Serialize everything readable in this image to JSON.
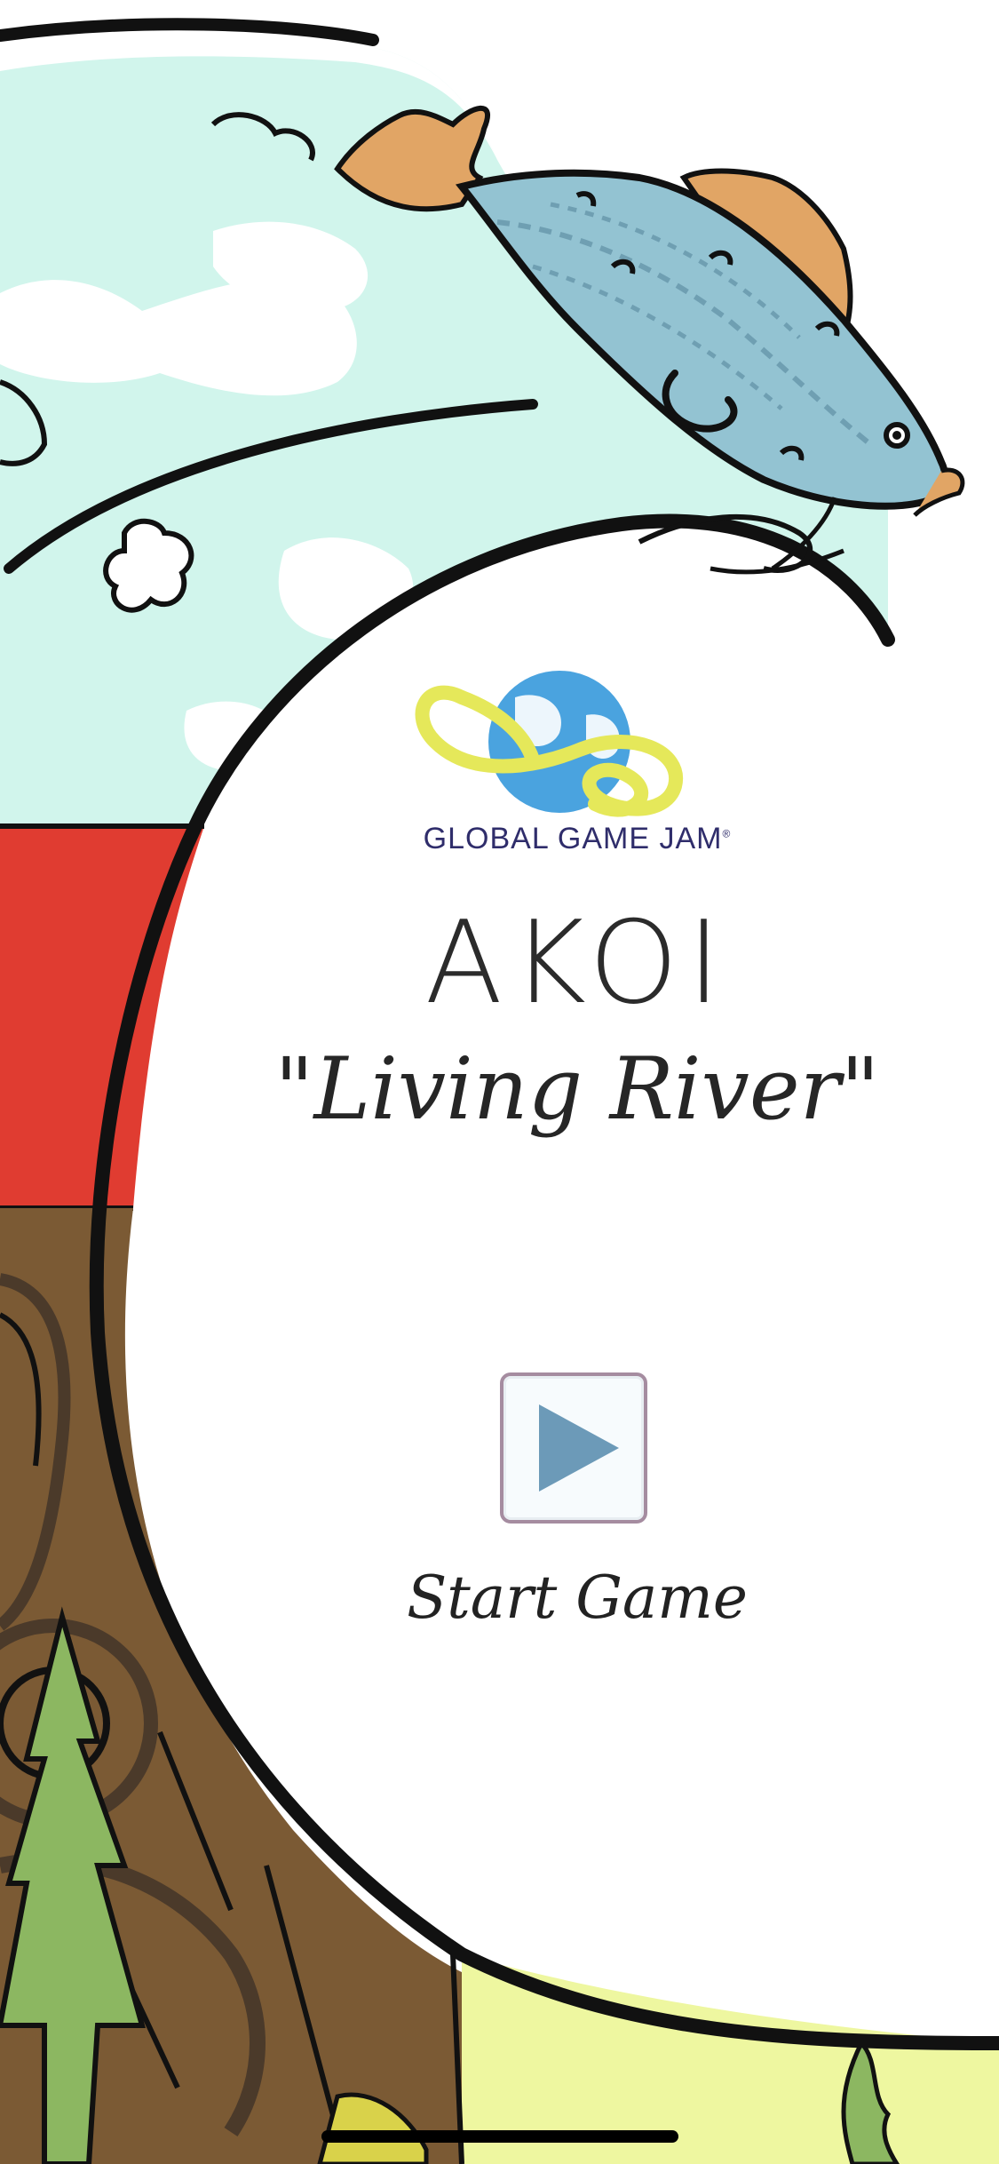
{
  "sponsor": {
    "logo_text": "GLOBAL GAME JAM",
    "registered_mark": "®"
  },
  "game": {
    "title": "AKOI",
    "subtitle": "\"Living River\""
  },
  "menu": {
    "start_label": "Start Game",
    "play_icon": "play-triangle-icon"
  },
  "colors": {
    "sky": "#d1f5ec",
    "red_band": "#e03c31",
    "ground": "#7b5a34",
    "grass": "#eef7a0",
    "fish_body": "#93c3d2",
    "fish_fin": "#e1a565",
    "tree": "#8cb761",
    "globe": "#4aa3df",
    "loop": "#e5e85a",
    "play_triangle": "#6c9ab8"
  }
}
